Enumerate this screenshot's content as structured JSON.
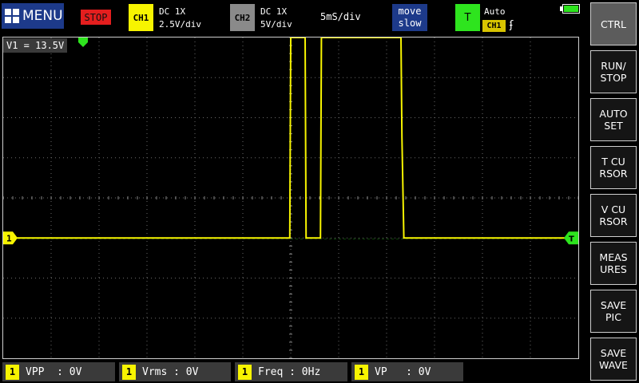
{
  "menu": {
    "label": "MENU",
    "icon": "grid-icon"
  },
  "run_state": {
    "label": "STOP",
    "color": "#e41e1e"
  },
  "ch1": {
    "tag": "CH1",
    "coupling": "DC  1X",
    "scale": "2.5V/div",
    "color": "#f7f400"
  },
  "ch2": {
    "tag": "CH2",
    "coupling": "DC  1X",
    "scale": "5V/div",
    "color": "#8a8a8a"
  },
  "timebase": {
    "label": "5mS/div"
  },
  "move": {
    "line1": "move",
    "line2": "slow"
  },
  "trigger": {
    "tag": "T",
    "mode": "Auto",
    "source": "CH1",
    "edge": "ʄ",
    "color": "#2ee41e"
  },
  "battery": {
    "level": 1.0,
    "icon": "battery-icon"
  },
  "cursor_readout": {
    "label": "V1 = 13.5V"
  },
  "channel_marker": {
    "label": "1"
  },
  "measurements": [
    {
      "ch": "1",
      "text": "VPP  : 0V"
    },
    {
      "ch": "1",
      "text": "Vrms : 0V"
    },
    {
      "ch": "1",
      "text": "Freq : 0Hz"
    },
    {
      "ch": "1",
      "text": "VP   : 0V"
    }
  ],
  "sidebar": [
    {
      "label": "CTRL",
      "active": true
    },
    {
      "label": "RUN/\nSTOP"
    },
    {
      "label": "AUTO\nSET"
    },
    {
      "label": "T CU\nRSOR"
    },
    {
      "label": "V CU\nRSOR"
    },
    {
      "label": "MEAS\nURES"
    },
    {
      "label": "SAVE\nPIC"
    },
    {
      "label": "SAVE\nWAVE"
    }
  ],
  "chart_data": {
    "type": "line",
    "title": "",
    "xlabel": "",
    "ylabel": "",
    "x_unit": "div",
    "y_unit": "V",
    "grid": true,
    "x_divisions": 12,
    "y_divisions": 8,
    "xlim": [
      0,
      12
    ],
    "ylim": [
      -7.5,
      12.5
    ],
    "series": [
      {
        "color": "#f7f400",
        "x": [
          0,
          5.98,
          6.0,
          6.3,
          6.32,
          6.62,
          6.64,
          8.3,
          8.32,
          8.36,
          12
        ],
        "y": [
          0,
          0,
          12.5,
          12.5,
          0,
          0,
          12.5,
          12.5,
          6.3,
          0,
          0
        ]
      }
    ],
    "cursor_level_v": 13.5
  }
}
